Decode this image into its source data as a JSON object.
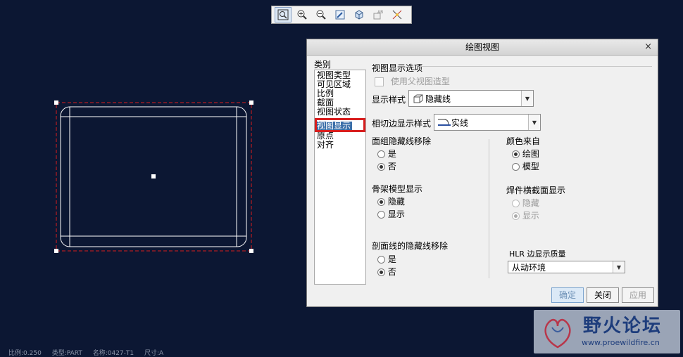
{
  "toolbar": {
    "buttons": [
      {
        "icon": "zoom-fit-icon"
      },
      {
        "icon": "zoom-in-icon"
      },
      {
        "icon": "zoom-out-icon"
      },
      {
        "icon": "repaint-icon"
      },
      {
        "icon": "view-orientation-icon"
      },
      {
        "icon": "annotation-display-icon"
      },
      {
        "icon": "datum-display-icon"
      }
    ]
  },
  "dialog": {
    "title": "绘图视图",
    "close": "×",
    "category_label": "类别",
    "categories": [
      "视图类型",
      "可见区域",
      "比例",
      "截面",
      "视图状态",
      "视图显示",
      "原点",
      "对齐"
    ],
    "selected_category_index": 5,
    "section_title": "视图显示选项",
    "use_parent_label": "使用父视图造型",
    "display_style": {
      "label": "显示样式",
      "value": "隐藏线"
    },
    "tangent_style": {
      "label": "相切边显示样式",
      "value": "实线"
    },
    "face_hidden": {
      "label": "面组隐藏线移除",
      "options": [
        "是",
        "否"
      ],
      "selected": "否"
    },
    "color_from": {
      "label": "颜色来自",
      "options": [
        "绘图",
        "模型"
      ],
      "selected": "绘图"
    },
    "skeleton": {
      "label": "骨架模型显示",
      "options": [
        "隐藏",
        "显示"
      ],
      "selected": "隐藏"
    },
    "weld_section": {
      "label": "焊件横截面显示",
      "options": [
        "隐藏",
        "显示"
      ],
      "selected": "显示"
    },
    "section_hidden": {
      "label": "剖面线的隐藏线移除",
      "options": [
        "是",
        "否"
      ],
      "selected": "否"
    },
    "hlr_quality": {
      "label": "HLR 边显示质量",
      "value": "从动环境"
    },
    "buttons": {
      "ok": "确定",
      "close": "关闭",
      "apply": "应用"
    }
  },
  "status_bar": [
    "比例:0.250",
    "类型:PART",
    "名称:0427-T1",
    "尺寸:A"
  ],
  "watermark": {
    "title": "野火论坛",
    "url": "www.proewildfire.cn"
  },
  "colors": {
    "background": "#0c1733",
    "selection_highlight": "#d81e1e",
    "list_selection": "#3b6ea8"
  }
}
